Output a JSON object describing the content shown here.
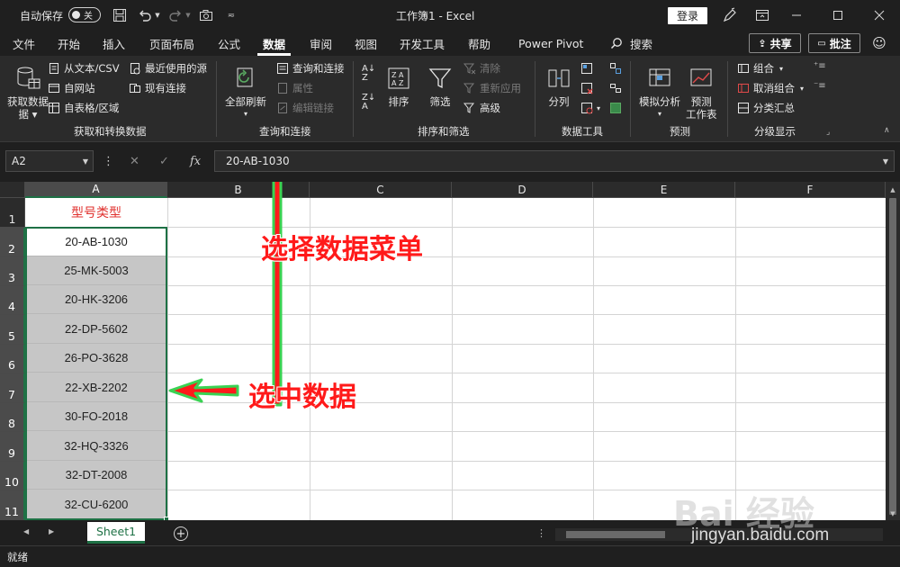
{
  "titlebar": {
    "autosave_label": "自动保存",
    "autosave_state": "关",
    "doc_title": "工作簿1  -  Excel",
    "login_label": "登录"
  },
  "menu": {
    "tabs": [
      "文件",
      "开始",
      "插入",
      "页面布局",
      "公式",
      "数据",
      "审阅",
      "视图",
      "开发工具",
      "帮助",
      "Power Pivot"
    ],
    "active_tab": "数据",
    "search_label": "搜索",
    "share_label": "共享",
    "comment_label": "批注"
  },
  "ribbon": {
    "get_data": {
      "get_data_label": "获取数据",
      "get_data_label2": "据",
      "from_text": "从文本/CSV",
      "from_web": "自网站",
      "from_table": "自表格/区域",
      "recent_sources": "最近使用的源",
      "existing_conn": "现有连接",
      "group_label": "获取和转换数据"
    },
    "queries": {
      "refresh_all": "全部刷新",
      "queries_conn": "查询和连接",
      "properties": "属性",
      "edit_links": "编辑链接",
      "group_label": "查询和连接"
    },
    "sort_filter": {
      "sort": "排序",
      "filter": "筛选",
      "clear": "清除",
      "reapply": "重新应用",
      "advanced": "高级",
      "group_label": "排序和筛选"
    },
    "data_tools": {
      "text_to_columns": "分列",
      "group_label": "数据工具"
    },
    "forecast": {
      "what_if": "模拟分析",
      "forecast_sheet": "预测",
      "forecast_sheet2": "工作表",
      "group_label": "预测"
    },
    "outline": {
      "group": "组合",
      "ungroup": "取消组合",
      "subtotal": "分类汇总",
      "group_label": "分级显示"
    }
  },
  "formula": {
    "name_box": "A2",
    "content": "20-AB-1030"
  },
  "grid": {
    "columns": [
      "A",
      "B",
      "C",
      "D",
      "E",
      "F"
    ],
    "rows": [
      "1",
      "2",
      "3",
      "4",
      "5",
      "6",
      "7",
      "8",
      "9",
      "10",
      "11"
    ],
    "header_cell": "型号类型",
    "values": [
      "20-AB-1030",
      "25-MK-5003",
      "20-HK-3206",
      "22-DP-5602",
      "26-PO-3628",
      "22-XB-2202",
      "30-FO-2018",
      "32-HQ-3326",
      "32-DT-2008",
      "32-CU-6200"
    ]
  },
  "sheets": {
    "tab": "Sheet1"
  },
  "status": {
    "text": "就绪"
  },
  "annotations": {
    "select_menu": "选择数据菜单",
    "select_data": "选中数据",
    "color": "#ff1a1a"
  },
  "watermark": {
    "logo": "Bai  经验",
    "url": "jingyan.baidu.com"
  }
}
